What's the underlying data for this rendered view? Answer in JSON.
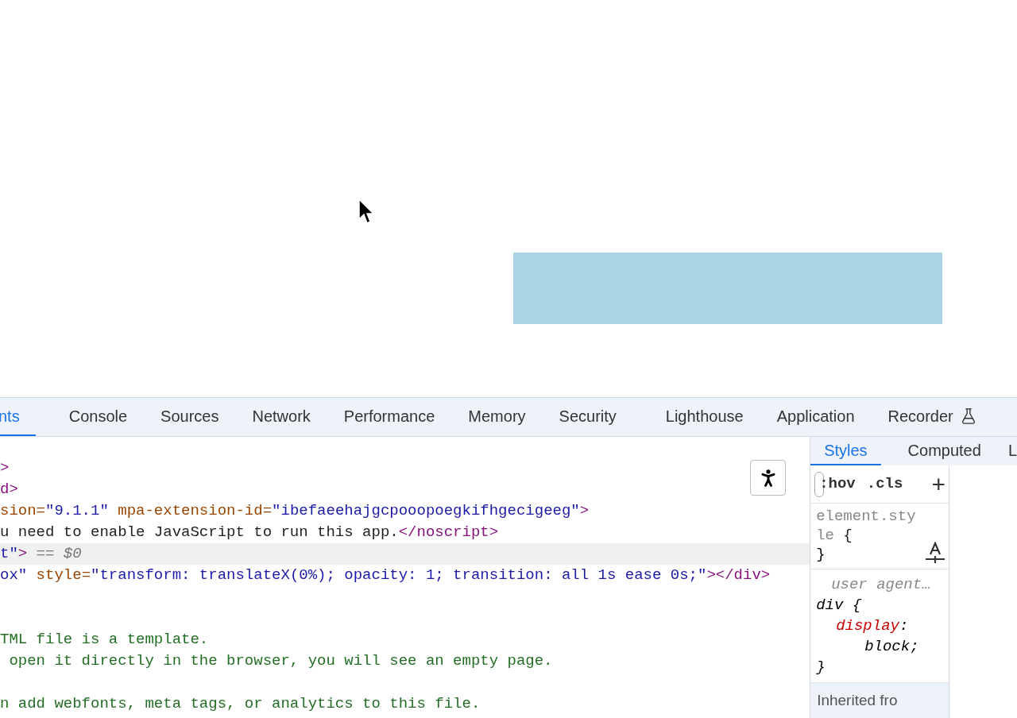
{
  "tabs": [
    {
      "label": "nts",
      "selected": true
    },
    {
      "label": "Console",
      "selected": false
    },
    {
      "label": "Sources",
      "selected": false
    },
    {
      "label": "Network",
      "selected": false
    },
    {
      "label": "Performance",
      "selected": false
    },
    {
      "label": "Memory",
      "selected": false
    },
    {
      "label": "Security",
      "selected": false
    },
    {
      "label": "Lighthouse",
      "selected": false
    },
    {
      "label": "Application",
      "selected": false
    },
    {
      "label": "Recorder",
      "selected": false
    }
  ],
  "code_lines": [
    {
      "selected": false,
      "segments": [
        {
          "kind": "tag",
          "text": ">"
        }
      ]
    },
    {
      "selected": false,
      "segments": [
        {
          "kind": "tag",
          "text": "d>"
        }
      ]
    },
    {
      "selected": false,
      "segments": [
        {
          "kind": "attr",
          "text": "sion="
        },
        {
          "kind": "value",
          "text": "\"9.1.1\""
        },
        {
          "kind": "attr",
          "text": " mpa-extension-id="
        },
        {
          "kind": "value",
          "text": "\"ibefaeehajgcpooopoegkifhgecigeeg\""
        },
        {
          "kind": "tag",
          "text": ">"
        }
      ]
    },
    {
      "selected": false,
      "segments": [
        {
          "kind": "text",
          "text": "u need to enable JavaScript to run this app."
        },
        {
          "kind": "tag",
          "text": "</noscript>"
        }
      ]
    },
    {
      "selected": true,
      "segments": [
        {
          "kind": "value",
          "text": "t\""
        },
        {
          "kind": "tag",
          "text": ">"
        },
        {
          "kind": "marker",
          "text": " == $0"
        }
      ]
    },
    {
      "selected": false,
      "segments": [
        {
          "kind": "value",
          "text": "ox\""
        },
        {
          "kind": "attr",
          "text": " style="
        },
        {
          "kind": "value",
          "text": "\"transform: translateX(0%); opacity: 1; transition: all 1s ease 0s;\""
        },
        {
          "kind": "tag",
          "text": "></div>"
        }
      ]
    },
    {
      "kind": "blank"
    },
    {
      "kind": "blank"
    },
    {
      "selected": false,
      "segments": [
        {
          "kind": "comment",
          "text": "TML file is a template."
        }
      ]
    },
    {
      "selected": false,
      "segments": [
        {
          "kind": "comment",
          "text": " open it directly in the browser, you will see an empty page."
        }
      ]
    },
    {
      "kind": "blank"
    },
    {
      "selected": false,
      "segments": [
        {
          "kind": "comment",
          "text": "n add webfonts, meta tags, or analytics to this file."
        }
      ]
    }
  ],
  "sidebar_tabs": [
    {
      "label": "Styles",
      "selected": true
    },
    {
      "label": "Computed",
      "selected": false
    },
    {
      "label": "L",
      "selected": false
    }
  ],
  "styles": {
    "filter_buttons": [
      ":hov",
      ".cls"
    ],
    "add_button": "+",
    "element_style": {
      "selector": "element.style",
      "open": " {",
      "close": "}"
    },
    "rule": {
      "origin": "user agent…",
      "selector": "div",
      "open": " {",
      "property": "display",
      "colon": ":",
      "value": "block;",
      "close": "}"
    },
    "inherited": "Inherited fro"
  }
}
